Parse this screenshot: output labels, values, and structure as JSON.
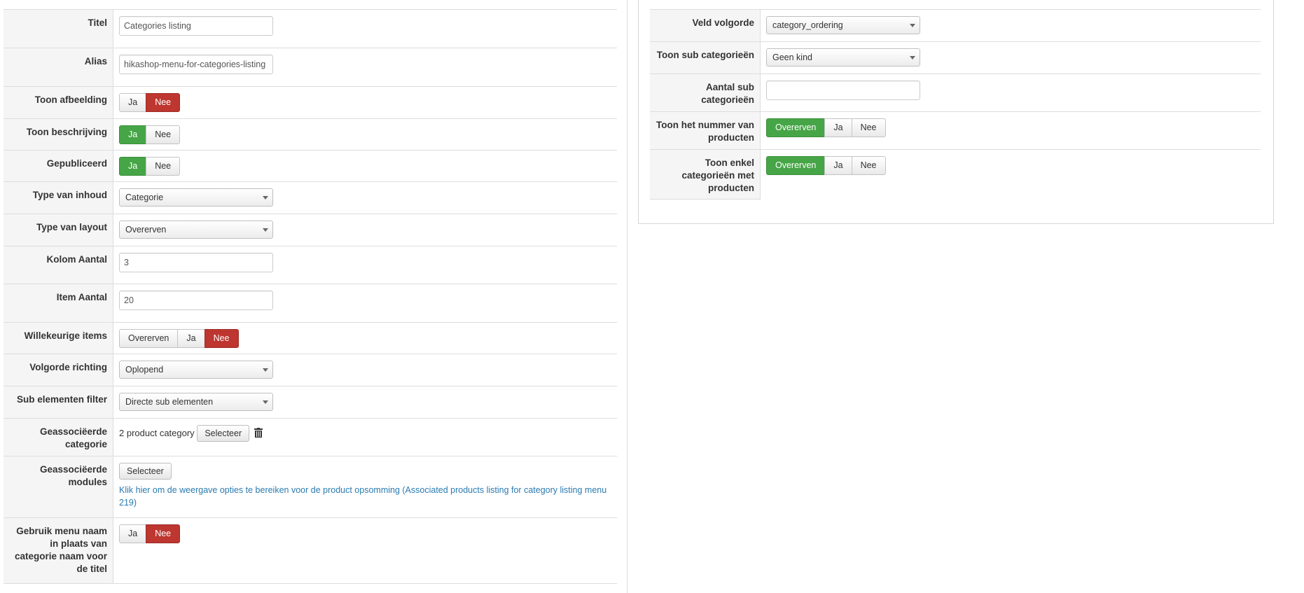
{
  "left_form": {
    "titel": {
      "label": "Titel",
      "value": "Categories listing"
    },
    "alias": {
      "label": "Alias",
      "value": "hikashop-menu-for-categories-listing"
    },
    "toon_afbeelding": {
      "label": "Toon afbeelding",
      "options": [
        "Ja",
        "Nee"
      ],
      "selected": "Nee"
    },
    "toon_beschrijving": {
      "label": "Toon beschrijving",
      "options": [
        "Ja",
        "Nee"
      ],
      "selected": "Ja"
    },
    "gepubliceerd": {
      "label": "Gepubliceerd",
      "options": [
        "Ja",
        "Nee"
      ],
      "selected": "Ja"
    },
    "type_inhoud": {
      "label": "Type van inhoud",
      "value": "Categorie"
    },
    "type_layout": {
      "label": "Type van layout",
      "value": "Overerven"
    },
    "kolom_aantal": {
      "label": "Kolom Aantal",
      "value": "3"
    },
    "item_aantal": {
      "label": "Item Aantal",
      "value": "20"
    },
    "willekeurige": {
      "label": "Willekeurige items",
      "options": [
        "Overerven",
        "Ja",
        "Nee"
      ],
      "selected": "Nee"
    },
    "volgorde_richting": {
      "label": "Volgorde richting",
      "value": "Oplopend"
    },
    "sub_filter": {
      "label": "Sub elementen filter",
      "value": "Directe sub elementen"
    },
    "geass_categorie": {
      "label": "Geassociëerde categorie",
      "text": "2 product category",
      "button": "Selecteer"
    },
    "geass_modules": {
      "label": "Geassociëerde modules",
      "button": "Selecteer",
      "link": "Klik hier om de weergave opties te bereiken voor de product opsomming (Associated products listing for category listing menu 219)"
    },
    "gebruik_menu": {
      "label": "Gebruik menu naam in plaats van categorie naam voor de titel",
      "options": [
        "Ja",
        "Nee"
      ],
      "selected": "Nee"
    }
  },
  "right_form": {
    "veld_volgorde": {
      "label": "Veld volgorde",
      "value": "category_ordering"
    },
    "toon_sub": {
      "label": "Toon sub categorieën",
      "value": "Geen kind"
    },
    "aantal_sub": {
      "label": "Aantal sub categorieën",
      "value": ""
    },
    "toon_nummer": {
      "label": "Toon het nummer van producten",
      "options": [
        "Overerven",
        "Ja",
        "Nee"
      ],
      "selected": "Overerven"
    },
    "toon_enkel": {
      "label": "Toon enkel categorieën met producten",
      "options": [
        "Overerven",
        "Ja",
        "Nee"
      ],
      "selected": "Overerven"
    }
  },
  "colors": {
    "selected_green": "#46a546",
    "selected_red": "#bd362f",
    "link": "#2a7ab0"
  }
}
